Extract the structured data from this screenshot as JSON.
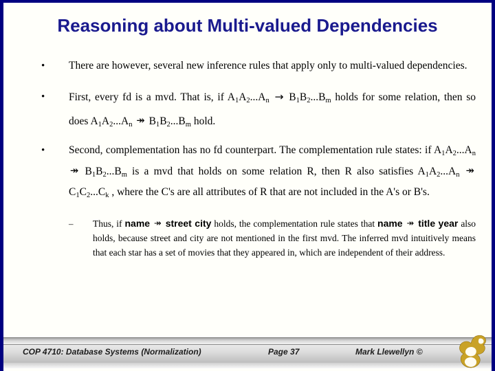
{
  "slide": {
    "title": "Reasoning about Multi-valued Dependencies",
    "accent_navy": "#000080",
    "title_color": "#1a1a8e",
    "background": "#fffffa"
  },
  "bullets": [
    {
      "marker": "•",
      "text_plain": "There are however, several new inference rules that apply only to multi-valued dependencies."
    },
    {
      "marker": "•",
      "text_plain": "First, every fd is a mvd.  That is, if A1A2...An → B1B2...Bm holds for some relation, then so does A1A2...An ↠ B1B2...Bm hold.",
      "part1": "First, every fd is a mvd.  That is, if",
      "A_left": "A",
      "A_sub1": "1",
      "A_mid": "A",
      "A_sub2": "2",
      "A_dots": "...A",
      "A_subn": "n",
      "fd_arrow": "→",
      "B_left": "B",
      "B_sub1": "1",
      "B_mid": "B",
      "B_sub2": "2",
      "B_dots": "...B",
      "B_subm": "m",
      "part2": "holds for some relation, then so does",
      "mvd_arrow": "↠",
      "part3": "hold."
    },
    {
      "marker": "•",
      "text_plain": "Second, complementation has no fd counterpart.  The complementation rule states: if A1A2...An ↠ B1B2...Bm is a mvd that holds on some relation R, then R also satisfies A1A2...An ↠ C1C2...Ck , where the C's are all attributes of R that are not included in the A's or B's.",
      "part1": "Second,  complementation  has  no  fd  counterpart.  The complementation rule states: if",
      "mvd_arrow": "↠",
      "part2": "is a mvd that holds on some relation R, then R also satisfies",
      "C_left": "C",
      "C_sub1": "1",
      "C_mid": "C",
      "C_sub2": "2",
      "C_dots": "...C",
      "C_subk": "k",
      "part3": ", where the C's are all attributes of R that are not included in the A's or B's."
    }
  ],
  "subbullet": {
    "marker": "–",
    "text_plain": "Thus, if name ↠ street city holds, the complementation rule states that name ↠ title year also holds, because street and city are not mentioned in the first mvd.  The inferred mvd intuitively means that each star has a set of movies that they appeared in, which are independent of their address.",
    "seg1": "Thus, if",
    "attr_name_1": "name",
    "arrow1": "↠",
    "attr_street_city": "street city",
    "seg2": "holds, the complementation rule states that",
    "attr_name_2": "name",
    "arrow2": "↠",
    "attr_title_year": "title year",
    "seg3": "also holds, because street and city are not mentioned in the first mvd.  The inferred mvd intuitively means that each star has a set of movies that they appeared in, which are independent of their address."
  },
  "footer": {
    "course": "COP 4710: Database Systems  (Normalization)",
    "page": "Page 37",
    "author": "Mark Llewellyn ©",
    "logo_name": "ucf-pegasus-logo",
    "logo_color": "#c9a227"
  }
}
